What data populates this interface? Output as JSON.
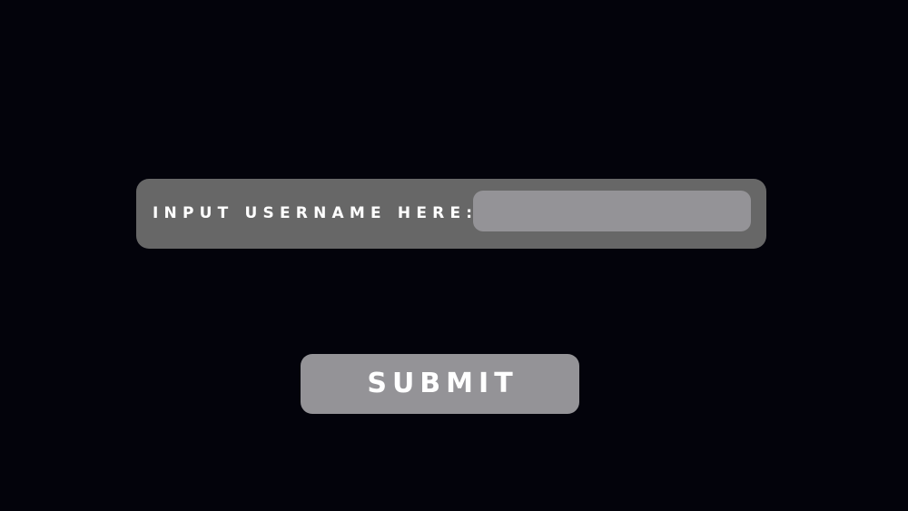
{
  "form": {
    "username_label": "INPUT USERNAME HERE:",
    "username_value": "",
    "username_placeholder": "",
    "submit_label": "SUBMIT"
  },
  "colors": {
    "background": "#03030b",
    "panel": "#676767",
    "input_fill": "#949397",
    "button_fill": "#949397",
    "text": "#ffffff"
  }
}
